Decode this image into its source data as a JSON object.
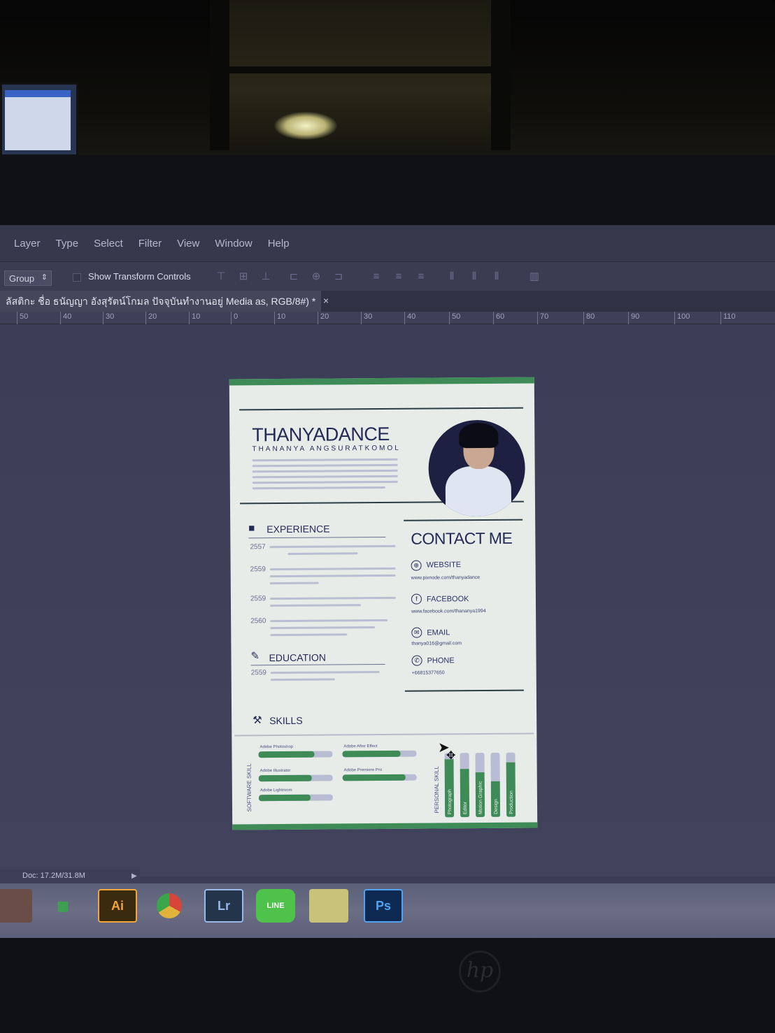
{
  "menu": {
    "items": [
      "Layer",
      "Type",
      "Select",
      "Filter",
      "View",
      "Window",
      "Help"
    ]
  },
  "options": {
    "group_value": "Group",
    "show_transform": "Show Transform Controls"
  },
  "document": {
    "tab_title": "ลัสติกะ ชื่อ ธนัญญา อังสุรัตน์โกมล ปัจจุบันทำงานอยู่ Media as, RGB/8#) *",
    "close_glyph": "×"
  },
  "ruler": {
    "labels": [
      "50",
      "40",
      "30",
      "20",
      "10",
      "0",
      "10",
      "20",
      "30",
      "40",
      "50",
      "60",
      "70",
      "80",
      "90",
      "100",
      "110"
    ]
  },
  "resume": {
    "name": "THANYADANCE",
    "full_name": "THANANYA ANGSURATKOMOL",
    "experience": {
      "title": "EXPERIENCE",
      "years": [
        "2557",
        "2559",
        "2559",
        "2560"
      ]
    },
    "education": {
      "title": "EDUCATION",
      "years": [
        "2559"
      ]
    },
    "skills": {
      "title": "SKILLS",
      "software_label": "SOFTWARE SKILL",
      "personal_label": "PERSONAL SKILL",
      "software": [
        {
          "name": "Adobe Photoshop",
          "level": 0.75
        },
        {
          "name": "Adobe Illustrator",
          "level": 0.72
        },
        {
          "name": "Adobe Lightroom",
          "level": 0.7
        },
        {
          "name": "Adobe After Effect",
          "level": 0.78
        },
        {
          "name": "Adobe Premiere Pro",
          "level": 0.85
        }
      ],
      "personal": [
        {
          "name": "Photograph",
          "level": 0.9
        },
        {
          "name": "Editor",
          "level": 0.75
        },
        {
          "name": "Motion Graphic",
          "level": 0.7
        },
        {
          "name": "Design",
          "level": 0.55
        },
        {
          "name": "Production",
          "level": 0.85
        }
      ]
    },
    "contact": {
      "title": "CONTACT ME",
      "website_label": "WEBSITE",
      "website_value": "www.pixnode.com/thanyadance",
      "facebook_label": "FACEBOOK",
      "facebook_value": "www.facebook.com/thananya1994",
      "email_label": "EMAIL",
      "email_value": "thanya016@gmail.com",
      "phone_label": "PHONE",
      "phone_value": "+66815377650"
    }
  },
  "status": {
    "doc_size": "Doc: 17.2M/31.8M"
  },
  "taskbar": {
    "apps": [
      {
        "name": "Firefox",
        "glyph": "",
        "color": "#e2642a"
      },
      {
        "name": "Store",
        "glyph": "▦",
        "color": "#3aa54a"
      },
      {
        "name": "Illustrator",
        "glyph": "Ai",
        "color": "#3a2a10"
      },
      {
        "name": "Chrome",
        "glyph": "",
        "color": "#e0b43a"
      },
      {
        "name": "Lightroom",
        "glyph": "Lr",
        "color": "#24344a"
      },
      {
        "name": "LINE",
        "glyph": "LINE",
        "color": "#4ec24a"
      },
      {
        "name": "Explorer",
        "glyph": "",
        "color": "#c9c27a"
      },
      {
        "name": "Photoshop",
        "glyph": "Ps",
        "color": "#0e2a52"
      }
    ]
  },
  "brand": {
    "logo": "hp"
  }
}
